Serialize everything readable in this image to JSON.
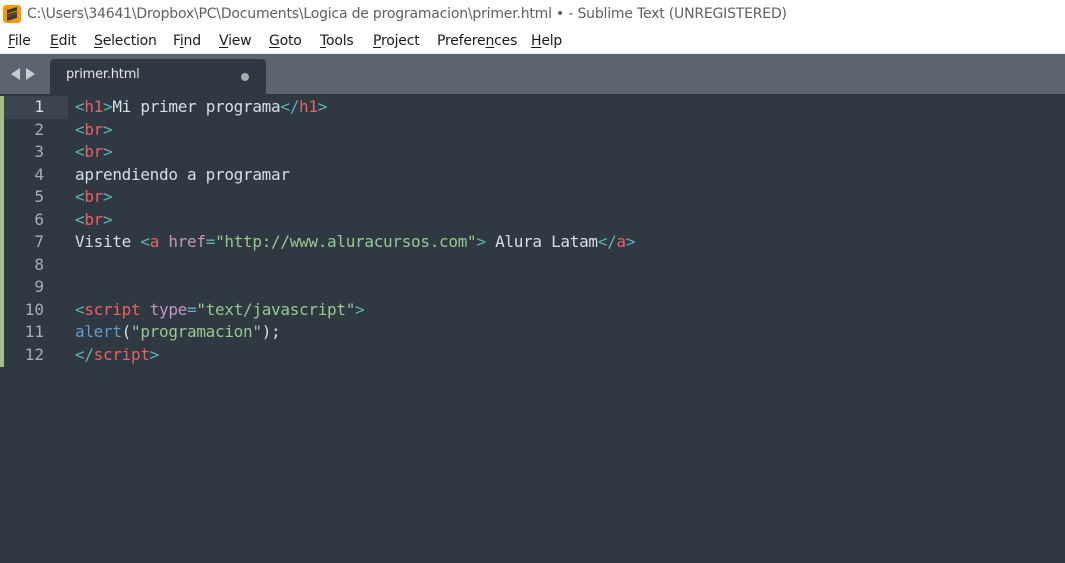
{
  "window": {
    "title": "C:\\Users\\34641\\Dropbox\\PC\\Documents\\Logica de programacion\\primer.html • - Sublime Text (UNREGISTERED)",
    "app_icon": "sublime-text-icon"
  },
  "menu": {
    "items": [
      {
        "pre": "",
        "u": "F",
        "post": "ile"
      },
      {
        "pre": "",
        "u": "E",
        "post": "dit"
      },
      {
        "pre": "",
        "u": "S",
        "post": "election"
      },
      {
        "pre": "F",
        "u": "i",
        "post": "nd"
      },
      {
        "pre": "",
        "u": "V",
        "post": "iew"
      },
      {
        "pre": "",
        "u": "G",
        "post": "oto"
      },
      {
        "pre": "",
        "u": "T",
        "post": "ools"
      },
      {
        "pre": "",
        "u": "P",
        "post": "roject"
      },
      {
        "pre": "Prefere",
        "u": "n",
        "post": "ces"
      },
      {
        "pre": "",
        "u": "H",
        "post": "elp"
      }
    ]
  },
  "tabs": [
    {
      "label": "primer.html",
      "modified": true
    }
  ],
  "editor": {
    "active_line": 1,
    "line_numbers": [
      "1",
      "2",
      "3",
      "4",
      "5",
      "6",
      "7",
      "8",
      "9",
      "10",
      "11",
      "12"
    ],
    "lines": [
      [
        [
          "pun",
          "<"
        ],
        [
          "tag",
          "h1"
        ],
        [
          "pun",
          ">"
        ],
        [
          "txt",
          "Mi primer programa"
        ],
        [
          "pun",
          "</"
        ],
        [
          "tag",
          "h1"
        ],
        [
          "pun",
          ">"
        ]
      ],
      [
        [
          "pun",
          "<"
        ],
        [
          "tag",
          "br"
        ],
        [
          "pun",
          ">"
        ]
      ],
      [
        [
          "pun",
          "<"
        ],
        [
          "tag",
          "br"
        ],
        [
          "pun",
          ">"
        ]
      ],
      [
        [
          "txt",
          "aprendiendo a programar"
        ]
      ],
      [
        [
          "pun",
          "<"
        ],
        [
          "tag",
          "br"
        ],
        [
          "pun",
          ">"
        ]
      ],
      [
        [
          "pun",
          "<"
        ],
        [
          "tag",
          "br"
        ],
        [
          "pun",
          ">"
        ]
      ],
      [
        [
          "txt",
          "Visite "
        ],
        [
          "pun",
          "<"
        ],
        [
          "tag",
          "a"
        ],
        [
          "txt",
          " "
        ],
        [
          "att",
          "href"
        ],
        [
          "pun",
          "="
        ],
        [
          "str",
          "\"http://www.aluracursos.com\""
        ],
        [
          "pun",
          ">"
        ],
        [
          "txt",
          " Alura Latam"
        ],
        [
          "pun",
          "</"
        ],
        [
          "tag",
          "a"
        ],
        [
          "pun",
          ">"
        ]
      ],
      [],
      [],
      [
        [
          "pun",
          "<"
        ],
        [
          "tag",
          "script"
        ],
        [
          "txt",
          " "
        ],
        [
          "att",
          "type"
        ],
        [
          "pun",
          "="
        ],
        [
          "str",
          "\"text/javascript\""
        ],
        [
          "pun",
          ">"
        ]
      ],
      [
        [
          "fn",
          "alert"
        ],
        [
          "txt",
          "("
        ],
        [
          "str",
          "\"programacion\""
        ],
        [
          "txt",
          ");"
        ]
      ],
      [
        [
          "pun",
          "</"
        ],
        [
          "tag",
          "script"
        ],
        [
          "pun",
          ">"
        ]
      ]
    ],
    "colors": {
      "background": "#303841",
      "tag": "#ec5f66",
      "punctuation": "#5fb4b4",
      "attribute": "#c594c5",
      "string": "#99c794",
      "function": "#6699cc",
      "text": "#d8dee9",
      "modified_marker": "#a3be8c"
    }
  }
}
